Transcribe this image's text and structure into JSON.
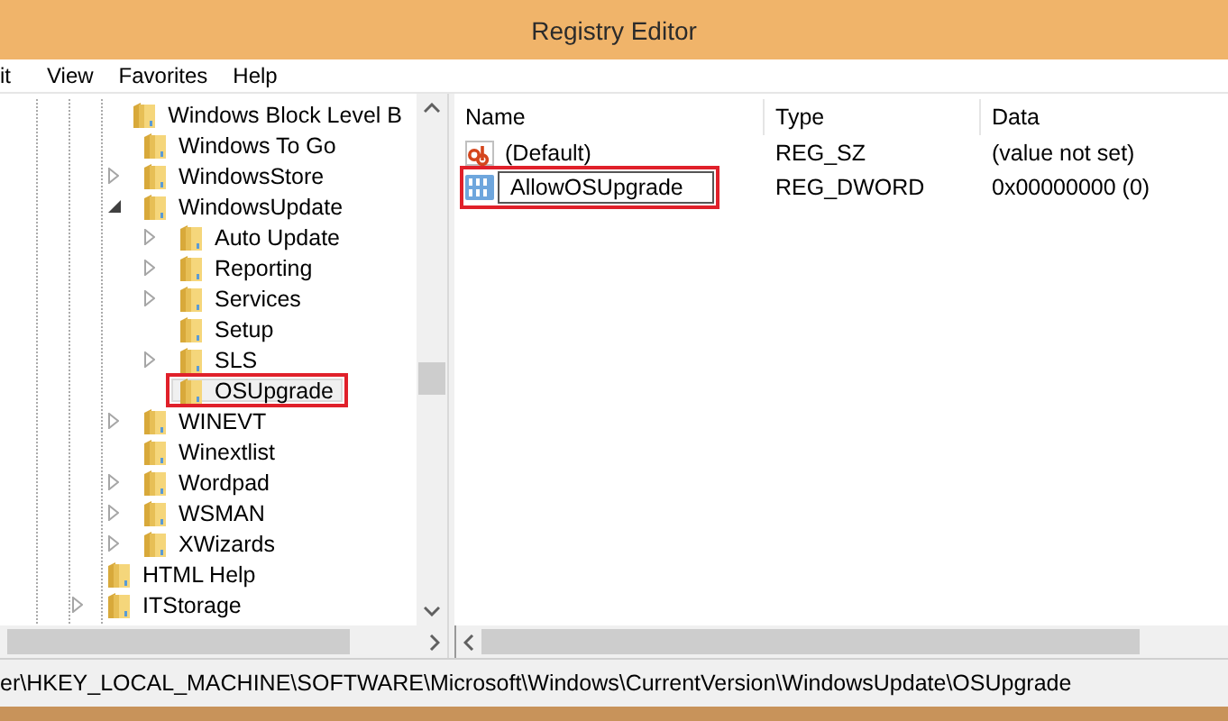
{
  "window": {
    "title": "Registry Editor"
  },
  "menu": [
    {
      "label": "it"
    },
    {
      "label": "View"
    },
    {
      "label": "Favorites"
    },
    {
      "label": "Help"
    }
  ],
  "tree": {
    "items": [
      {
        "children": [
          {
            "label": "Windows Block Level B",
            "has_children": false,
            "expanded": false,
            "selected": false,
            "highlighted": false
          },
          {
            "label": "Windows To Go",
            "has_children": false,
            "expanded": false,
            "selected": false,
            "highlighted": false
          },
          {
            "label": "WindowsStore",
            "has_children": true,
            "expanded": false,
            "selected": false,
            "highlighted": false
          },
          {
            "label": "WindowsUpdate",
            "has_children": true,
            "expanded": true,
            "selected": false,
            "highlighted": false,
            "children": [
              {
                "label": "Auto Update",
                "has_children": true,
                "expanded": false,
                "selected": false,
                "highlighted": false
              },
              {
                "label": "Reporting",
                "has_children": true,
                "expanded": false,
                "selected": false,
                "highlighted": false
              },
              {
                "label": "Services",
                "has_children": true,
                "expanded": false,
                "selected": false,
                "highlighted": false
              },
              {
                "label": "Setup",
                "has_children": false,
                "expanded": false,
                "selected": false,
                "highlighted": false
              },
              {
                "label": "SLS",
                "has_children": true,
                "expanded": false,
                "selected": false,
                "highlighted": false
              },
              {
                "label": "OSUpgrade",
                "has_children": false,
                "expanded": false,
                "selected": true,
                "highlighted": true
              }
            ]
          },
          {
            "label": "WINEVT",
            "has_children": true,
            "expanded": false,
            "selected": false,
            "highlighted": false
          },
          {
            "label": "Winextlist",
            "has_children": false,
            "expanded": false,
            "selected": false,
            "highlighted": false
          },
          {
            "label": "Wordpad",
            "has_children": true,
            "expanded": false,
            "selected": false,
            "highlighted": false
          },
          {
            "label": "WSMAN",
            "has_children": true,
            "expanded": false,
            "selected": false,
            "highlighted": false
          },
          {
            "label": "XWizards",
            "has_children": true,
            "expanded": false,
            "selected": false,
            "highlighted": false
          }
        ]
      },
      {
        "label": "HTML Help",
        "has_children": false,
        "expanded": false,
        "selected": false,
        "highlighted": false
      },
      {
        "label": "ITStorage",
        "has_children": true,
        "expanded": false,
        "selected": false,
        "highlighted": false
      }
    ]
  },
  "table": {
    "columns": [
      "Name",
      "Type",
      "Data"
    ],
    "rows": [
      {
        "kind": "string",
        "name": "(Default)",
        "type": "REG_SZ",
        "data": "(value not set)",
        "editing": false,
        "highlighted": false
      },
      {
        "kind": "dword",
        "name": "AllowOSUpgrade",
        "type": "REG_DWORD",
        "data": "0x00000000 (0)",
        "editing": true,
        "highlighted": true
      }
    ]
  },
  "status_bar": {
    "path": "er\\HKEY_LOCAL_MACHINE\\SOFTWARE\\Microsoft\\Windows\\CurrentVersion\\WindowsUpdate\\OSUpgrade"
  }
}
